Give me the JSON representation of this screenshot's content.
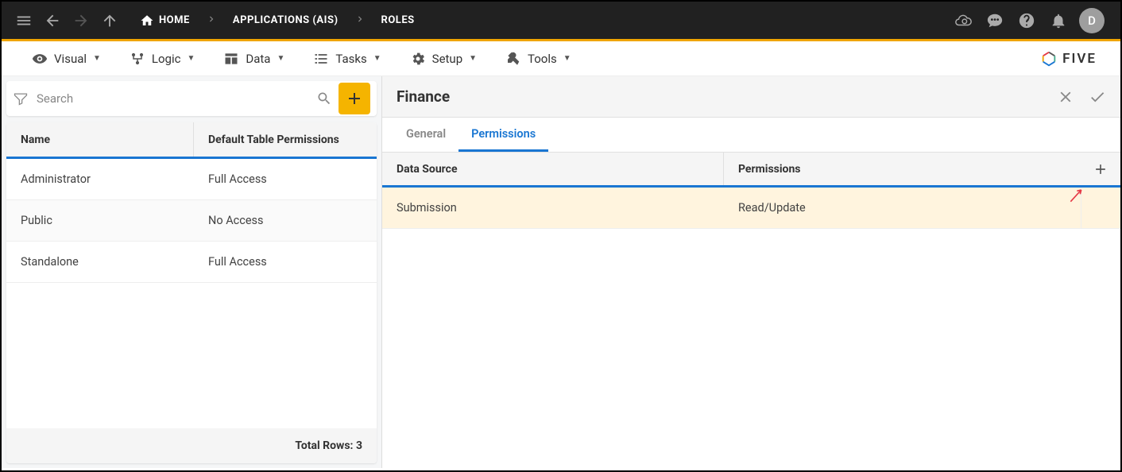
{
  "header": {
    "avatar_letter": "D"
  },
  "breadcrumb": {
    "home": "HOME",
    "applications": "APPLICATIONS (AIS)",
    "roles": "ROLES"
  },
  "menu": {
    "visual": "Visual",
    "logic": "Logic",
    "data": "Data",
    "tasks": "Tasks",
    "setup": "Setup",
    "tools": "Tools"
  },
  "logo": "FIVE",
  "search": {
    "placeholder": "Search"
  },
  "left_table": {
    "headers": {
      "name": "Name",
      "permissions": "Default Table Permissions"
    },
    "rows": [
      {
        "name": "Administrator",
        "permissions": "Full Access"
      },
      {
        "name": "Public",
        "permissions": "No Access"
      },
      {
        "name": "Standalone",
        "permissions": "Full Access"
      }
    ],
    "footer_label": "Total Rows:",
    "footer_count": "3"
  },
  "detail": {
    "title": "Finance",
    "tabs": {
      "general": "General",
      "permissions": "Permissions"
    },
    "table": {
      "headers": {
        "data_source": "Data Source",
        "permissions": "Permissions"
      },
      "rows": [
        {
          "data_source": "Submission",
          "permissions": "Read/Update"
        }
      ]
    }
  }
}
